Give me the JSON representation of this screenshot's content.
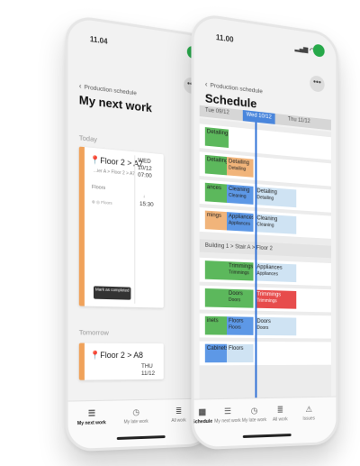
{
  "left_phone": {
    "status_time": "11.04",
    "breadcrumb": "Production schedule",
    "title": "My next work",
    "sections": [
      {
        "label": "Today",
        "card": {
          "location": "Floor 2 > A7",
          "path": "...ier A > Floor 2 > A7",
          "category": "Floors",
          "sub": "⊕ ◎ Floors",
          "date_day": "WED",
          "date": "10/12",
          "start": "07:00",
          "end": "15:30",
          "button": "Mark as completed"
        }
      },
      {
        "label": "Tomorrow",
        "card": {
          "location": "Floor 2 > A8",
          "date_day": "THU 11/12"
        }
      }
    ],
    "tabs": [
      {
        "label": "My next work",
        "icon": "list-icon"
      },
      {
        "label": "My late work",
        "icon": "clock-icon"
      },
      {
        "label": "All work",
        "icon": "stack-icon"
      }
    ]
  },
  "right_phone": {
    "status_time": "11.00",
    "breadcrumb": "Production schedule",
    "title": "Schedule",
    "days": [
      "Tue 09/12",
      "Wed 10/12",
      "Thu 11/12"
    ],
    "rows": [
      [
        {
          "t": "Detailing",
          "s": "",
          "c": "green"
        }
      ],
      [
        {
          "t": "Detailing",
          "s": "",
          "c": "green"
        },
        {
          "t": "Detailing",
          "s": "Detailing",
          "c": "orange"
        }
      ],
      [
        {
          "t": "ances",
          "s": "",
          "c": "green"
        },
        {
          "t": "Cleaning",
          "s": "Cleaning",
          "c": "blue"
        },
        {
          "t": "Detailing",
          "s": "Detailing",
          "c": "lblue"
        }
      ],
      [
        {
          "t": "mings",
          "s": "",
          "c": "orange"
        },
        {
          "t": "Appliances",
          "s": "Appliances",
          "c": "blue"
        },
        {
          "t": "Cleaning",
          "s": "Cleaning",
          "c": "lblue"
        }
      ]
    ],
    "section": "Building 1 > Stair A > Floor 2",
    "rows2": [
      [
        {
          "t": "",
          "s": "",
          "c": "green"
        },
        {
          "t": "Trimmings",
          "s": "Trimmings",
          "c": "green"
        },
        {
          "t": "Appliances",
          "s": "Appliances",
          "c": "lblue"
        }
      ],
      [
        {
          "t": "",
          "s": "",
          "c": "green"
        },
        {
          "t": "Doors",
          "s": "Doors",
          "c": "green"
        },
        {
          "t": "Trimmings",
          "s": "Trimmings",
          "c": "red"
        }
      ],
      [
        {
          "t": "inets",
          "s": "",
          "c": "green"
        },
        {
          "t": "Floors",
          "s": "Floors",
          "c": "blue"
        },
        {
          "t": "Doors",
          "s": "Doors",
          "c": "lblue"
        }
      ],
      [
        {
          "t": "Cabinets",
          "s": "",
          "c": "blue"
        },
        {
          "t": "Floors",
          "s": "",
          "c": "lblue"
        }
      ]
    ],
    "tabs": [
      {
        "label": "Schedule",
        "icon": "calendar-icon"
      },
      {
        "label": "My next work",
        "icon": "list-icon"
      },
      {
        "label": "My late work",
        "icon": "clock-icon"
      },
      {
        "label": "All work",
        "icon": "stack-icon"
      },
      {
        "label": "Issues",
        "icon": "warning-icon"
      }
    ]
  },
  "colors": {
    "accent_blue": "#4a86dc",
    "green": "#5cb85c",
    "orange": "#f1b47a",
    "red": "#e74c4c",
    "battery": "#27a94a"
  }
}
